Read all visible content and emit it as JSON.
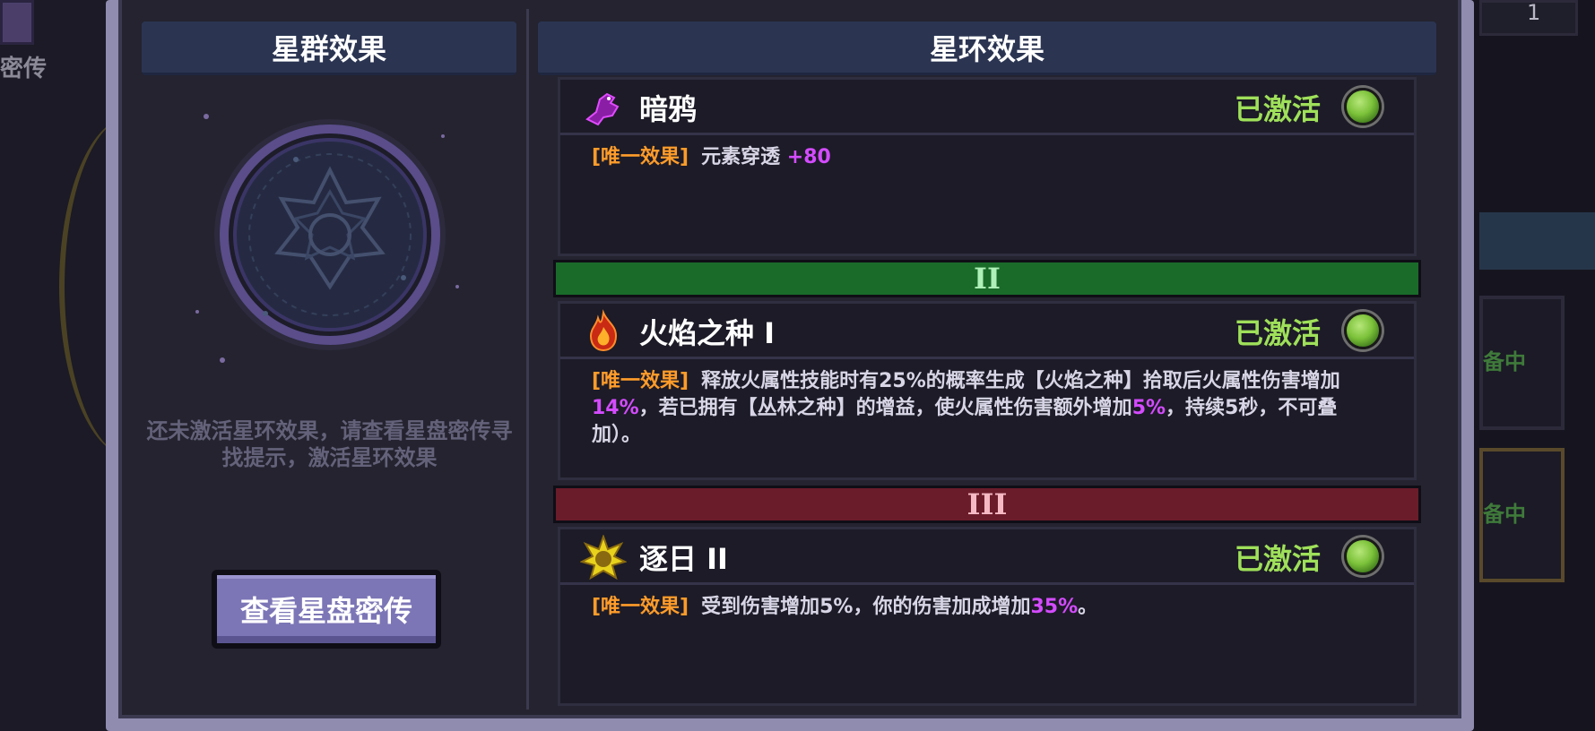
{
  "background": {
    "left_label": "密传",
    "right_top_count": "1",
    "right_card_labels": [
      "备中",
      "备中"
    ]
  },
  "left_panel": {
    "title": "星群效果",
    "hint": "还未激活星环效果，请查看星盘密传寻找提示，激活星环效果",
    "button": "查看星盘密传"
  },
  "right_panel": {
    "title": "星环效果",
    "tiers": [
      "II",
      "III"
    ],
    "effects": [
      {
        "icon": "dark-crow-icon",
        "name": "暗鸦",
        "status": "已激活",
        "tag": "[唯一效果]",
        "desc_parts": [
          "元素穿透 ",
          "+80"
        ]
      },
      {
        "icon": "flame-seed-icon",
        "name": "火焰之种 I",
        "status": "已激活",
        "tag": "[唯一效果]",
        "desc_parts": [
          "释放火属性技能时有25%的概率生成【火焰之种】拾取后火属性伤害增加",
          "14%",
          "，若已拥有【丛林之种】的增益，使火属性伤害额外增加",
          "5%",
          "，持续5秒，不可叠加）。"
        ]
      },
      {
        "icon": "sun-chaser-icon",
        "name": "逐日 II",
        "status": "已激活",
        "tag": "[唯一效果]",
        "desc_parts": [
          "受到伤害增加5%，你的伤害加成增加",
          "35%",
          "。"
        ]
      }
    ]
  },
  "colors": {
    "active_green": "#9fe05a",
    "tag_orange": "#ff9c2a",
    "highlight_purple": "#d44bff",
    "tier2_bg": "#1a6b2a",
    "tier3_bg": "#6b1c2a",
    "button_purple": "#7c76b6"
  }
}
